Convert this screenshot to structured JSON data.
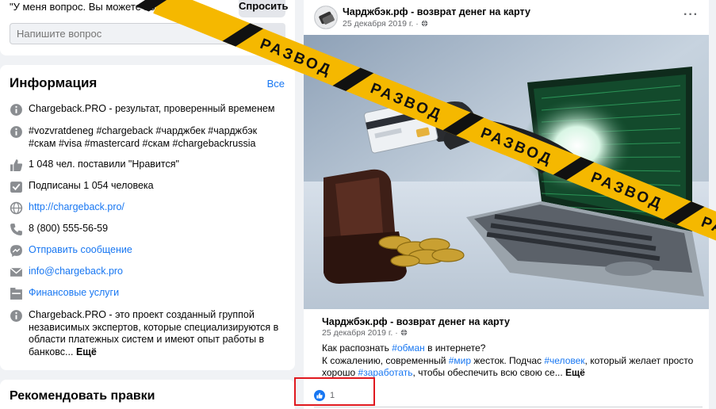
{
  "ask": {
    "question": "\"У меня вопрос. Вы можете помочь?\"",
    "ask_button": "Спросить",
    "input_placeholder": "Напишите вопрос"
  },
  "info": {
    "title": "Информация",
    "see_all": "Все",
    "items": [
      {
        "icon": "info-icon",
        "text": "Chargeback.PRO - результат, проверенный временем"
      },
      {
        "icon": "info-icon",
        "text": "#vozvratdeneg #chargeback #чарджбек #чарджбэк #скам #visa #mastercard #скам #chargebackrussia"
      },
      {
        "icon": "thumbs-up-icon",
        "text": "1 048 чел. поставили \"Нравится\""
      },
      {
        "icon": "subscribers-icon",
        "text": "Подписаны 1 054 человека"
      },
      {
        "icon": "globe-icon",
        "text": "http://chargeback.pro/"
      },
      {
        "icon": "phone-icon",
        "text": "8 (800) 555-56-59"
      },
      {
        "icon": "messenger-icon",
        "text": "Отправить сообщение"
      },
      {
        "icon": "email-icon",
        "text": "info@chargeback.pro"
      },
      {
        "icon": "category-icon",
        "text": "Финансовые услуги"
      },
      {
        "icon": "info-icon",
        "text": "Chargeback.PRO - это проект созданный группой независимых экспертов, которые специализируются в области платежных систем и имеют опыт работы в банковс...",
        "more": "Ещё"
      }
    ]
  },
  "suggest": {
    "title": "Рекомендовать правки"
  },
  "post": {
    "author": "Чарджбэк.рф - возврат денег на карту",
    "date": "25 декабря 2019 г. ·",
    "more_icon": "···",
    "preview_title": "Чарджбэк.рф - возврат денег на карту",
    "preview_date": "25 декабря 2019 г. ·",
    "text_line1_a": "Как распознать ",
    "tag_fraud": "#обман",
    "text_line1_b": " в интернете?",
    "text_line2_a": "К сожалению, современный ",
    "tag_world": "#мир",
    "text_line2_b": " жесток. Подчас ",
    "tag_person": "#человек",
    "text_line2_c": ", который желает просто хорошо ",
    "tag_earn": "#заработать",
    "text_line2_d": ", чтобы обеспечить всю свою се... ",
    "more": "Ещё",
    "like_count": "1"
  },
  "tape": {
    "word": "РАЗВОД",
    "color": "#f5b800"
  },
  "colors": {
    "link": "#1877f2",
    "highlight": "#e0191f",
    "background": "#f0f2f5"
  }
}
